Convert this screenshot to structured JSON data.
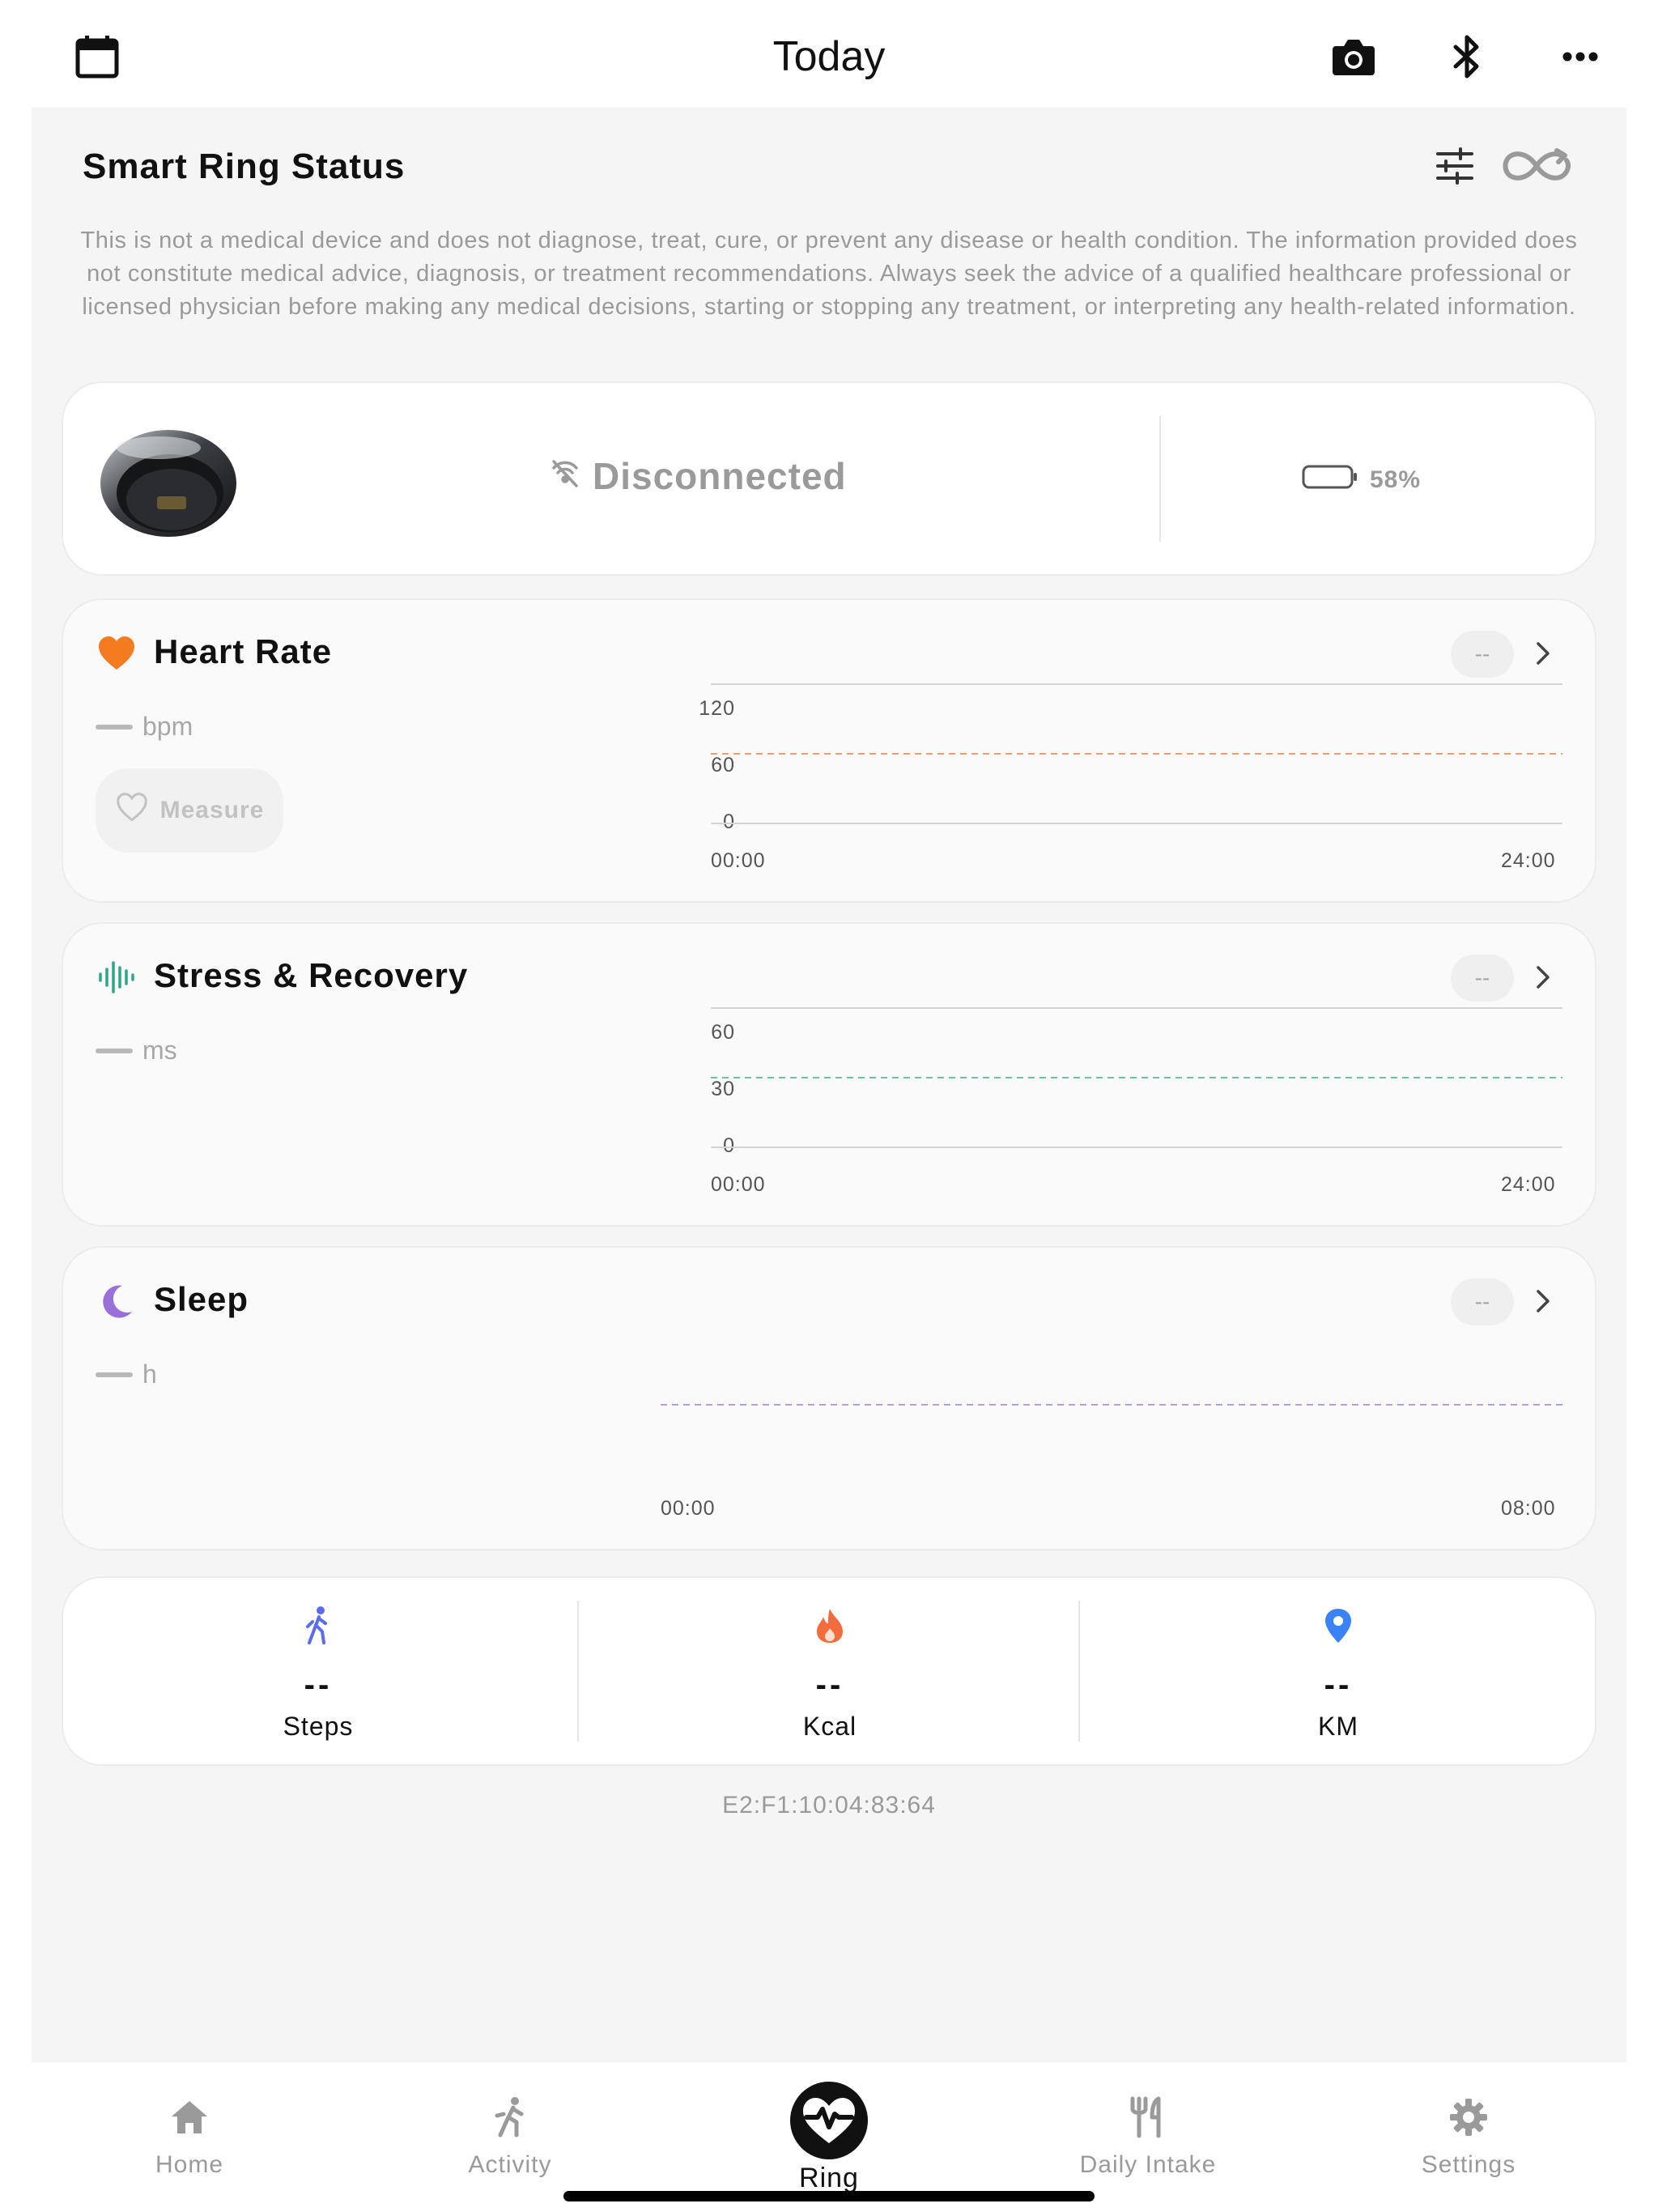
{
  "header": {
    "title": "Today",
    "icons": [
      "calendar-icon",
      "camera-icon",
      "bluetooth-icon",
      "more-icon"
    ]
  },
  "panel": {
    "title": "Smart Ring Status",
    "icons": [
      "sliders-icon",
      "infinity-sync-icon"
    ],
    "disclaimer": "This is not a medical device and does not diagnose, treat, cure, or prevent any disease or health condition. The information provided does not constitute medical advice, diagnosis, or treatment recommendations. Always seek the advice of a qualified healthcare professional or licensed physician before making any medical decisions, starting or stopping any treatment, or interpreting any health-related information."
  },
  "ring": {
    "status": "Disconnected",
    "battery_label": "58%",
    "battery_level": 0.58
  },
  "heart_rate": {
    "title": "Heart Rate",
    "value": "--",
    "unit": "bpm",
    "measure_label": "Measure",
    "color": "#f47b20",
    "y_ticks": [
      "120",
      "60",
      "0"
    ],
    "x_start": "00:00",
    "x_end": "24:00"
  },
  "stress": {
    "title": "Stress & Recovery",
    "value": "--",
    "unit": "ms",
    "color": "#2fa58a",
    "y_ticks": [
      "60",
      "30",
      "0"
    ],
    "x_start": "00:00",
    "x_end": "24:00"
  },
  "sleep": {
    "title": "Sleep",
    "value": "--",
    "unit": "h",
    "color": "#9b6fd9",
    "x_start": "00:00",
    "x_end": "08:00"
  },
  "activity": [
    {
      "value": "--",
      "label": "Steps",
      "icon": "walking-icon",
      "color": "#5b6cf0"
    },
    {
      "value": "--",
      "label": "Kcal",
      "icon": "flame-icon",
      "color": "#f46b3d"
    },
    {
      "value": "--",
      "label": "KM",
      "icon": "location-pin-icon",
      "color": "#3b82f6"
    }
  ],
  "device_mac": "E2:F1:10:04:83:64",
  "tabs": [
    {
      "label": "Home",
      "icon": "home-icon"
    },
    {
      "label": "Activity",
      "icon": "running-icon"
    },
    {
      "label": "Ring",
      "icon": "ring-heart-icon",
      "active": true
    },
    {
      "label": "Daily Intake",
      "icon": "utensils-icon"
    },
    {
      "label": "Settings",
      "icon": "gear-icon"
    }
  ]
}
